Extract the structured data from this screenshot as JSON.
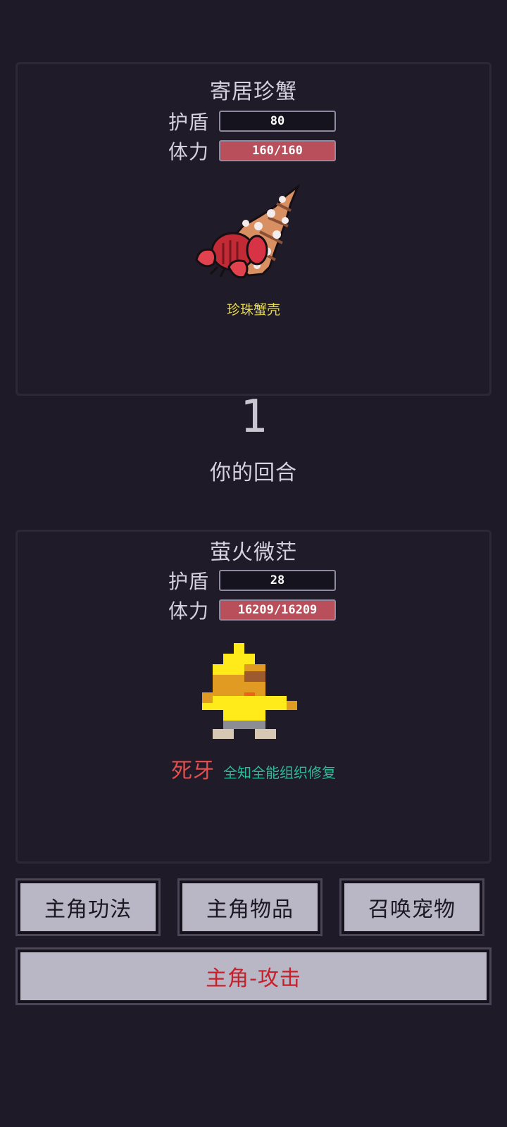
{
  "enemy": {
    "name": "寄居珍蟹",
    "shield_label": "护盾",
    "shield_value": "80",
    "hp_label": "体力",
    "hp_value": "160/160",
    "item_label": "珍珠蟹壳",
    "sprite_icon": "hermit-crab-icon"
  },
  "turn": {
    "number": "1",
    "label": "你的回合"
  },
  "player": {
    "name": "萤火微茫",
    "shield_label": "护盾",
    "shield_value": "28",
    "hp_label": "体力",
    "hp_value": "16209/16209",
    "weapon_name": "死牙",
    "skill_name": "全知全能组织修复",
    "sprite_icon": "pixel-hero-icon"
  },
  "actions": {
    "skills_label": "主角功法",
    "items_label": "主角物品",
    "summon_label": "召唤宠物",
    "attack_label": "主角-攻击"
  },
  "colors": {
    "background": "#1e1a28",
    "hp_bar": "#b84f5a",
    "item_label": "#e6d94a",
    "weapon": "#e0504e",
    "skill": "#2fb89a",
    "attack_text": "#c8202a"
  }
}
